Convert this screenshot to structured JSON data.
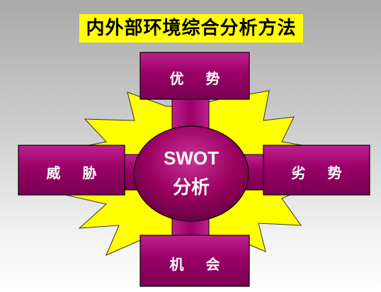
{
  "title": "内外部环境综合分析方法",
  "center": {
    "line1": "SWOT",
    "line2": "分析"
  },
  "quadrants": {
    "top": "优 势",
    "left": "威 胁",
    "right": "劣 势",
    "bottom": "机 会"
  },
  "colors": {
    "title_bg": "#ffff00",
    "starburst": "#ffff00",
    "box_fill": "#990066",
    "box_light": "#cc33aa",
    "outline": "#000000",
    "text": "#ffffff"
  }
}
